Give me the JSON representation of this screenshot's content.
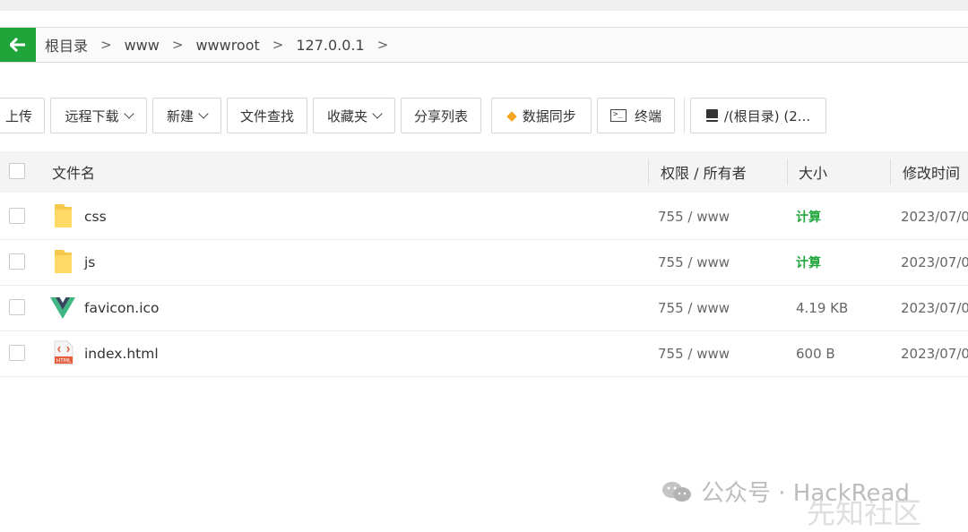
{
  "breadcrumb": {
    "back_icon": "arrow-left-icon",
    "items": [
      "根目录",
      "www",
      "wwwroot",
      "127.0.0.1"
    ]
  },
  "toolbar": {
    "upload": "上传",
    "remote_download": "远程下载",
    "new": "新建",
    "file_search": "文件查找",
    "favorites": "收藏夹",
    "share_list": "分享列表",
    "data_sync": "数据同步",
    "terminal": "终端",
    "disk": "/(根目录) (2..."
  },
  "table": {
    "headers": {
      "name": "文件名",
      "perm": "权限 / 所有者",
      "size": "大小",
      "mtime": "修改时间"
    },
    "rows": [
      {
        "name": "css",
        "type": "folder",
        "perm": "755 / www",
        "size": "计算",
        "mtime": "2023/07/0"
      },
      {
        "name": "js",
        "type": "folder",
        "perm": "755 / www",
        "size": "计算",
        "mtime": "2023/07/0"
      },
      {
        "name": "favicon.ico",
        "type": "vue-logo",
        "perm": "755 / www",
        "size": "4.19 KB",
        "mtime": "2023/07/0"
      },
      {
        "name": "index.html",
        "type": "html-file",
        "perm": "755 / www",
        "size": "600 B",
        "mtime": "2023/07/0"
      }
    ]
  },
  "watermark": {
    "line1": "公众号 · HackRead",
    "line2": "先知社区"
  },
  "colors": {
    "accent": "#20a53a",
    "folder": "#ffd966",
    "vue_green": "#41b883",
    "vue_dark": "#34495e",
    "html_orange": "#e55b3c"
  }
}
